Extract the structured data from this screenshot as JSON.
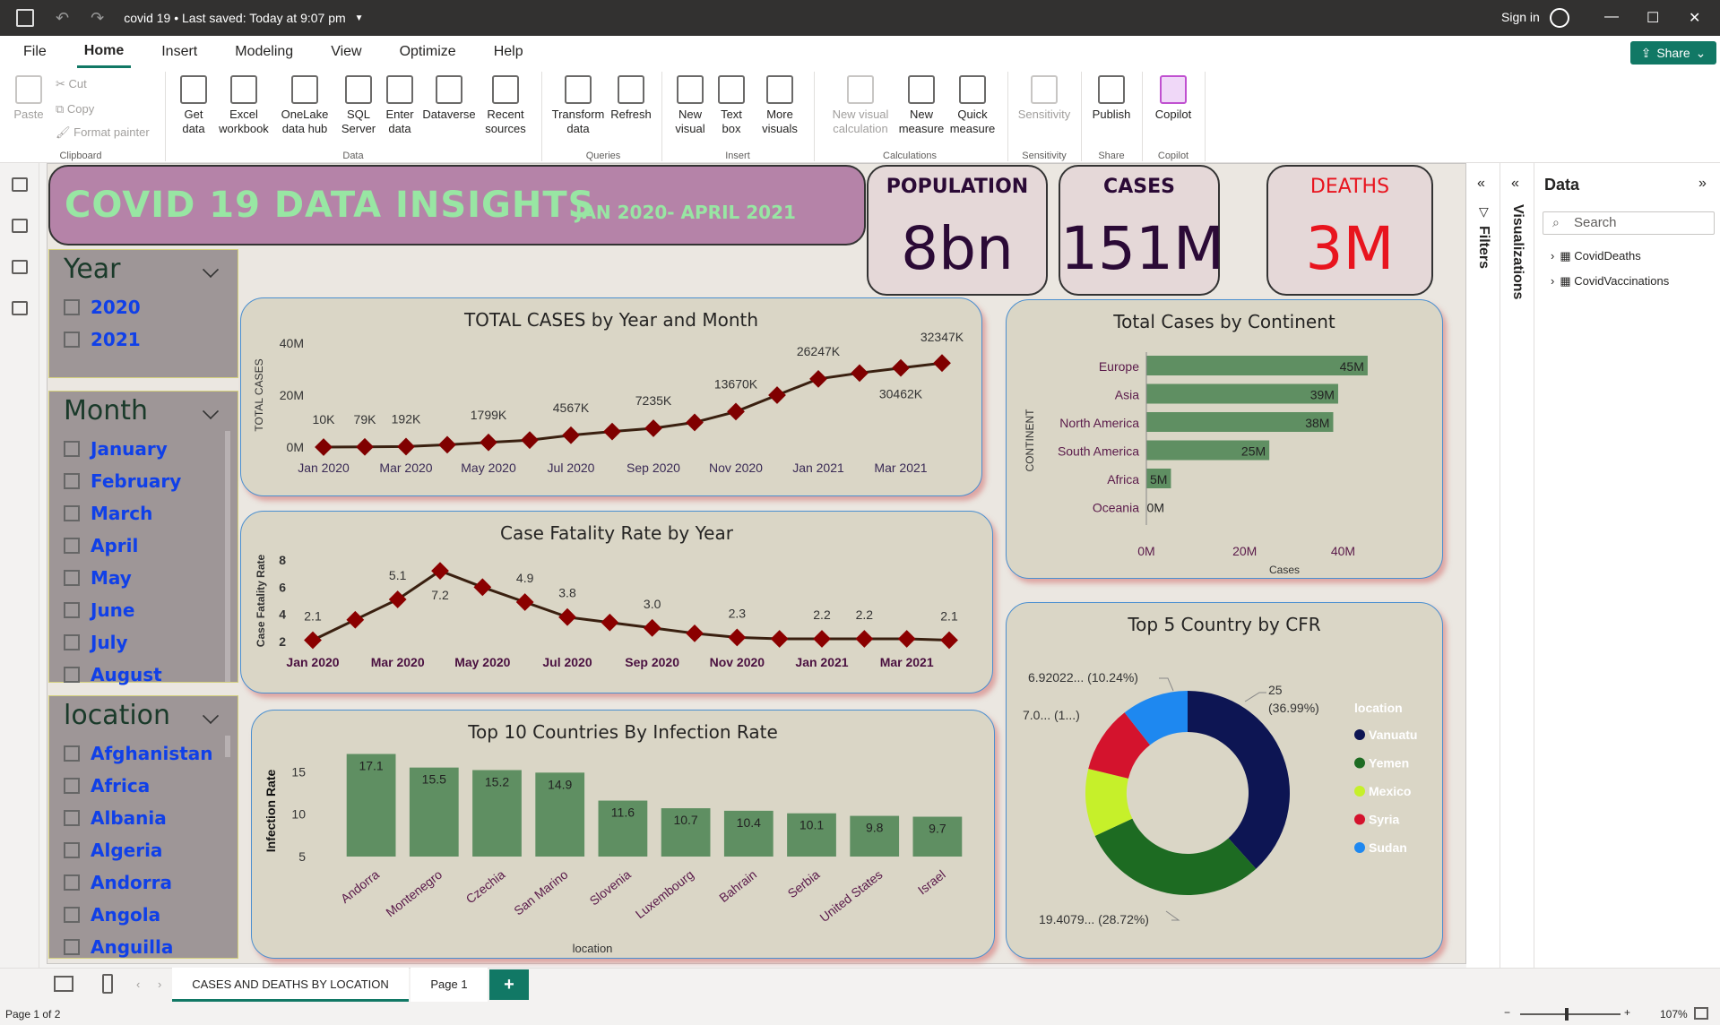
{
  "window": {
    "doc_title": "covid 19 • Last saved: Today at 9:07 pm",
    "signin": "Sign in"
  },
  "menu": [
    "File",
    "Home",
    "Insert",
    "Modeling",
    "View",
    "Optimize",
    "Help"
  ],
  "share_label": "Share",
  "ribbon": {
    "clipboard": {
      "paste": "Paste",
      "cut": "Cut",
      "copy": "Copy",
      "format_painter": "Format painter",
      "group": "Clipboard"
    },
    "data": {
      "get_data": "Get data",
      "excel": "Excel workbook",
      "onelake": "OneLake data hub",
      "sql": "SQL Server",
      "enter": "Enter data",
      "dataverse": "Dataverse",
      "recent": "Recent sources",
      "group": "Data"
    },
    "queries": {
      "transform": "Transform data",
      "refresh": "Refresh",
      "group": "Queries"
    },
    "insert": {
      "new_visual": "New visual",
      "text_box": "Text box",
      "more_visuals": "More visuals",
      "group": "Insert"
    },
    "calculations": {
      "new_visual_calc": "New visual calculation",
      "new_measure": "New measure",
      "quick_measure": "Quick measure",
      "group": "Calculations"
    },
    "sensitivity": {
      "label": "Sensitivity",
      "group": "Sensitivity"
    },
    "share": {
      "publish": "Publish",
      "group": "Share"
    },
    "copilot": {
      "label": "Copilot",
      "group": "Copilot"
    }
  },
  "report": {
    "title": "COVID 19 DATA INSIGHTS",
    "subtitle": "JAN 2020- APRIL  2021",
    "kpis": [
      {
        "label": "POPULATION",
        "value": "8bn",
        "color": "#2b0a36"
      },
      {
        "label": "CASES",
        "value": "151M",
        "color": "#2b0a36"
      },
      {
        "label": "DEATHS",
        "value": "3M",
        "color": "#e8141e"
      }
    ],
    "slicers": {
      "year": {
        "title": "Year",
        "items": [
          "2020",
          "2021"
        ]
      },
      "month": {
        "title": "Month",
        "items": [
          "January",
          "February",
          "March",
          "April",
          "May",
          "June",
          "July",
          "August"
        ]
      },
      "location": {
        "title": "location",
        "items": [
          "Afghanistan",
          "Africa",
          "Albania",
          "Algeria",
          "Andorra",
          "Angola",
          "Anguilla"
        ]
      }
    }
  },
  "chart_data": [
    {
      "type": "line",
      "title": "TOTAL CASES by Year and Month",
      "ylabel": "TOTAL CASES",
      "y_ticks": [
        "0M",
        "20M",
        "40M"
      ],
      "ylim": [
        0,
        40000000
      ],
      "x_ticks": [
        "Jan 2020",
        "Mar 2020",
        "May 2020",
        "Jul 2020",
        "Sep 2020",
        "Nov 2020",
        "Jan 2021",
        "Mar 2021"
      ],
      "x": [
        "Jan 2020",
        "Feb 2020",
        "Mar 2020",
        "Apr 2020",
        "May 2020",
        "Jun 2020",
        "Jul 2020",
        "Aug 2020",
        "Sep 2020",
        "Oct 2020",
        "Nov 2020",
        "Dec 2020",
        "Jan 2021",
        "Feb 2021",
        "Mar 2021",
        "Apr 2021"
      ],
      "values": [
        10000,
        79000,
        192000,
        900000,
        1799000,
        2700000,
        4567000,
        6000000,
        7235000,
        9500000,
        13670000,
        20000000,
        26247000,
        28500000,
        30462000,
        32347000
      ],
      "labels": [
        "10K",
        "79K",
        "192K",
        "",
        "1799K",
        "",
        "4567K",
        "",
        "7235K",
        "",
        "13670K",
        "",
        "26247K",
        "",
        "30462K",
        "32347K"
      ],
      "color": "#800000"
    },
    {
      "type": "line",
      "title": "Case Fatality Rate by Year",
      "ylabel": "Case Fatality Rate",
      "y_ticks": [
        "2",
        "4",
        "6",
        "8"
      ],
      "ylim": [
        2,
        8
      ],
      "x_ticks": [
        "Jan 2020",
        "Mar 2020",
        "May 2020",
        "Jul 2020",
        "Sep 2020",
        "Nov 2020",
        "Jan 2021",
        "Mar 2021"
      ],
      "x": [
        "Jan 2020",
        "Feb 2020",
        "Mar 2020",
        "Apr 2020",
        "May 2020",
        "Jun 2020",
        "Jul 2020",
        "Aug 2020",
        "Sep 2020",
        "Oct 2020",
        "Nov 2020",
        "Dec 2020",
        "Jan 2021",
        "Feb 2021",
        "Mar 2021",
        "Apr 2021"
      ],
      "values": [
        2.1,
        3.6,
        5.1,
        7.2,
        6.0,
        4.9,
        3.8,
        3.4,
        3.0,
        2.6,
        2.3,
        2.2,
        2.2,
        2.2,
        2.2,
        2.1
      ],
      "labels": [
        "2.1",
        "",
        "5.1",
        "7.2",
        "",
        "4.9",
        "3.8",
        "",
        "3.0",
        "",
        "2.3",
        "",
        "2.2",
        "2.2",
        "",
        "2.1"
      ],
      "color": "#8b0000"
    },
    {
      "type": "bar",
      "title": "Top 10 Countries By Infection Rate",
      "ylabel": "Infection Rate",
      "xlabel": "location",
      "y_ticks": [
        "5",
        "10",
        "15"
      ],
      "ylim": [
        5,
        18
      ],
      "categories": [
        "Andorra",
        "Montenegro",
        "Czechia",
        "San Marino",
        "Slovenia",
        "Luxembourg",
        "Bahrain",
        "Serbia",
        "United States",
        "Israel"
      ],
      "values": [
        17.1,
        15.5,
        15.2,
        14.9,
        11.6,
        10.7,
        10.4,
        10.1,
        9.8,
        9.7
      ],
      "color": "#5f8f62"
    },
    {
      "type": "bar",
      "title": "Total Cases by Continent",
      "ylabel": "CONTINENT",
      "xlabel": "Cases",
      "x_ticks": [
        "0M",
        "20M",
        "40M"
      ],
      "xlim": [
        0,
        50000000
      ],
      "categories": [
        "Europe",
        "Asia",
        "North America",
        "South America",
        "Africa",
        "Oceania"
      ],
      "values": [
        45000000,
        39000000,
        38000000,
        25000000,
        5000000,
        0
      ],
      "labels": [
        "45M",
        "39M",
        "38M",
        "25M",
        "5M",
        "0M"
      ],
      "color": "#5f8f62"
    },
    {
      "type": "pie",
      "title": "Top 5 Country by CFR",
      "legend_title": "location",
      "series": [
        {
          "name": "Vanuatu",
          "value": 25,
          "label": "25 (36.99%)",
          "color": "#0d1553"
        },
        {
          "name": "Yemen",
          "value": 19.4079,
          "label": "19.4079... (28.72%)",
          "color": "#1d6b22"
        },
        {
          "name": "Mexico",
          "value": 7.0,
          "label": "7.0... (1...)",
          "color": "#c6f02a"
        },
        {
          "name": "Syria",
          "value": 6.92022,
          "label": "6.92022... (10.24%)",
          "color": "#d4132d"
        },
        {
          "name": "Sudan",
          "value": 6.9,
          "label": "",
          "color": "#1e88f0"
        }
      ]
    }
  ],
  "right_panes": {
    "filters": "Filters",
    "visualizations": "Visualizations",
    "data_title": "Data",
    "search_placeholder": "Search",
    "tables": [
      "CovidDeaths",
      "CovidVaccinations"
    ]
  },
  "pages": {
    "active": "CASES AND DEATHS BY LOCATION",
    "other": "Page 1",
    "add": "+"
  },
  "status": {
    "page": "Page 1 of 2",
    "zoom": "107%"
  }
}
